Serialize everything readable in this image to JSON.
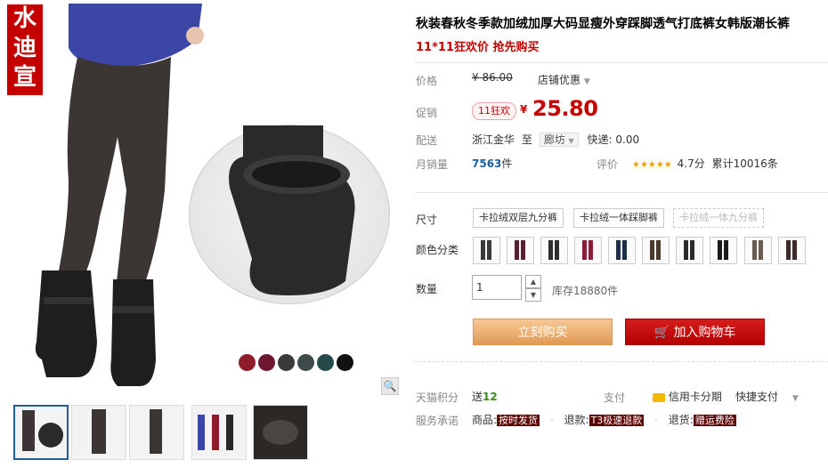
{
  "shop_logo": "水迪宣",
  "product": {
    "title": "秋装春秋冬季款加绒加厚大码显瘦外穿踩脚透气打底裤女韩版潮长裤",
    "promo": "11*11狂欢价 抢先购买"
  },
  "price": {
    "label": "价格",
    "currency": "¥",
    "original": "86.00",
    "shop_discount": "店铺优惠",
    "promo_label": "促销",
    "promo_badge": "11狂欢",
    "promo_price": "25.80"
  },
  "delivery": {
    "label": "配送",
    "from": "浙江金华",
    "to_word": "至",
    "to": "廊坊",
    "express": "快递: 0.00"
  },
  "sales": {
    "label": "月销量",
    "count": "7563",
    "unit": "件",
    "rating_label": "评价",
    "stars": "★★★★★",
    "score": "4.7分",
    "total": "累计10016条"
  },
  "size": {
    "label": "尺寸",
    "options": [
      "卡拉绒双层九分裤",
      "卡拉绒一体踩脚裤",
      "卡拉绒一体九分裤"
    ]
  },
  "color": {
    "label": "颜色分类",
    "swatches": [
      "#3a3a3a",
      "#5a2030",
      "#2e2e2e",
      "#8a1c3c",
      "#1d2f4a",
      "#4a3b30",
      "#2b2b2b",
      "#1a1a1a",
      "#6b5a50",
      "#3c2a2a"
    ]
  },
  "quantity": {
    "label": "数量",
    "value": "1",
    "stock": "库存18880件"
  },
  "buttons": {
    "buy_now": "立刻购买",
    "add_cart": "加入购物车"
  },
  "points": {
    "label": "天猫积分",
    "send": "送",
    "amount": "12",
    "pay_label": "支付",
    "credit": "信用卡分期",
    "quick": "快捷支付"
  },
  "service": {
    "label": "服务承诺",
    "goods": "商品:",
    "goods_tag": "按时发货",
    "refund": "退款:",
    "refund_tag": "T3极速退款",
    "return": "退货:",
    "return_tag": "赠运费险"
  },
  "gallery": {
    "zoom_icon": "magnifier-icon",
    "circle_swatches": [
      "#8e1b2a",
      "#6e1530",
      "#3a3a3a",
      "#3f4a4a",
      "#254a4a",
      "#111111"
    ]
  }
}
